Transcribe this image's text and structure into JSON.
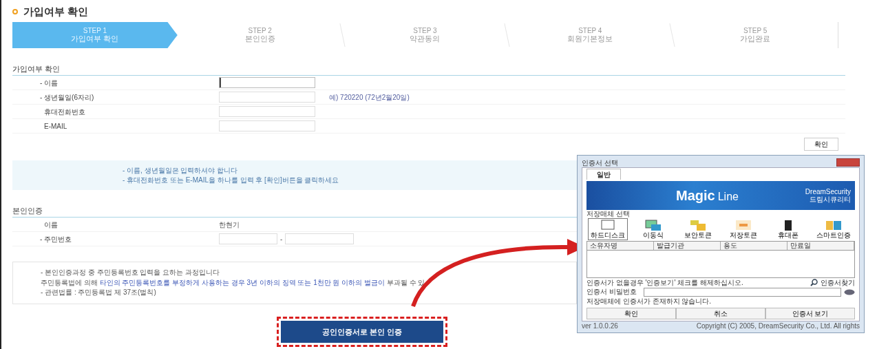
{
  "page_title": "가입여부 확인",
  "steps": [
    {
      "step": "STEP 1",
      "label": "가입여부 확인",
      "selected": true
    },
    {
      "step": "STEP 2",
      "label": "본인인증",
      "selected": false
    },
    {
      "step": "STEP 3",
      "label": "약관동의",
      "selected": false
    },
    {
      "step": "STEP 4",
      "label": "회원기본정보",
      "selected": false
    },
    {
      "step": "STEP 5",
      "label": "가입완료",
      "selected": false
    }
  ],
  "membership_check": {
    "heading": "가입여부 확인",
    "fields": [
      {
        "label": "- 이름",
        "focused": true
      },
      {
        "label": "- 생년월일(6자리)",
        "hint": "예) 720220 (72년2월20일)",
        "focused": false
      },
      {
        "label": "휴대전화번호",
        "focused": false
      },
      {
        "label": "E-MAIL",
        "focused": false
      }
    ],
    "button": "확인",
    "notes": [
      "- 이름, 생년월일은 입력하셔야 합니다",
      "- 휴대전화번호 또는 E-MAIL을 하나를 입력 후 [확인]버튼을 클릭하세요"
    ]
  },
  "identity": {
    "heading": "본인인증",
    "name_label": "이름",
    "name_value": "한현기",
    "rrn_label": "- 주민번호",
    "rrn_separator": "-",
    "notes": [
      [
        {
          "text": "- 본인인증과정 중 주민등록번호 입력을 요하는 과정입니다",
          "emphasis": false
        }
      ],
      [
        {
          "text": "주민등록법에 의해 ",
          "emphasis": false
        },
        {
          "text": "타인의 주민등록번호를 부정하게 사용하는 경우 3년 이하의 징역 또는 1천만 원 이하의 벌금이",
          "emphasis": true
        },
        {
          "text": " 부과될 수 있",
          "emphasis": false
        }
      ],
      [
        {
          "text": "- 관련법률 : 주민등록법 제 37조(벌칙)",
          "emphasis": false
        }
      ]
    ],
    "button": "공인인증서로 본인 인증"
  },
  "dialog": {
    "title": "인증서 선택",
    "tab": "일반",
    "banner_title": "Magic",
    "banner_subtitle": "Line",
    "logo_text": "DreamSecurity",
    "logo_caption": "드림시큐리티",
    "media_heading": "저장매체 선택",
    "media": [
      {
        "label": "하드디스크",
        "kind": "disk",
        "selected": true
      },
      {
        "label": "이동식",
        "kind": "usb",
        "selected": false
      },
      {
        "label": "보안토큰",
        "kind": "token",
        "selected": false
      },
      {
        "label": "저장토큰",
        "kind": "storage",
        "selected": false
      },
      {
        "label": "휴대폰",
        "kind": "phone",
        "selected": false
      },
      {
        "label": "스마트인증",
        "kind": "smart",
        "selected": false
      }
    ],
    "columns": [
      "소유자명",
      "발급기관",
      "용도",
      "만료일"
    ],
    "hint": "인증서가 없을경우 '인증보기' 체크를 해제하십시오.",
    "find_link": "인증서찾기",
    "password_label": "인증서 비밀번호",
    "status": "저장매체에 인증서가 존재하지 않습니다.",
    "buttons": [
      "확인",
      "취소",
      "인증서 보기"
    ],
    "version": "ver 1.0.0.26",
    "copyright": "Copyright (C) 2005, DreamSecurity Co., Ltd. All rights"
  }
}
